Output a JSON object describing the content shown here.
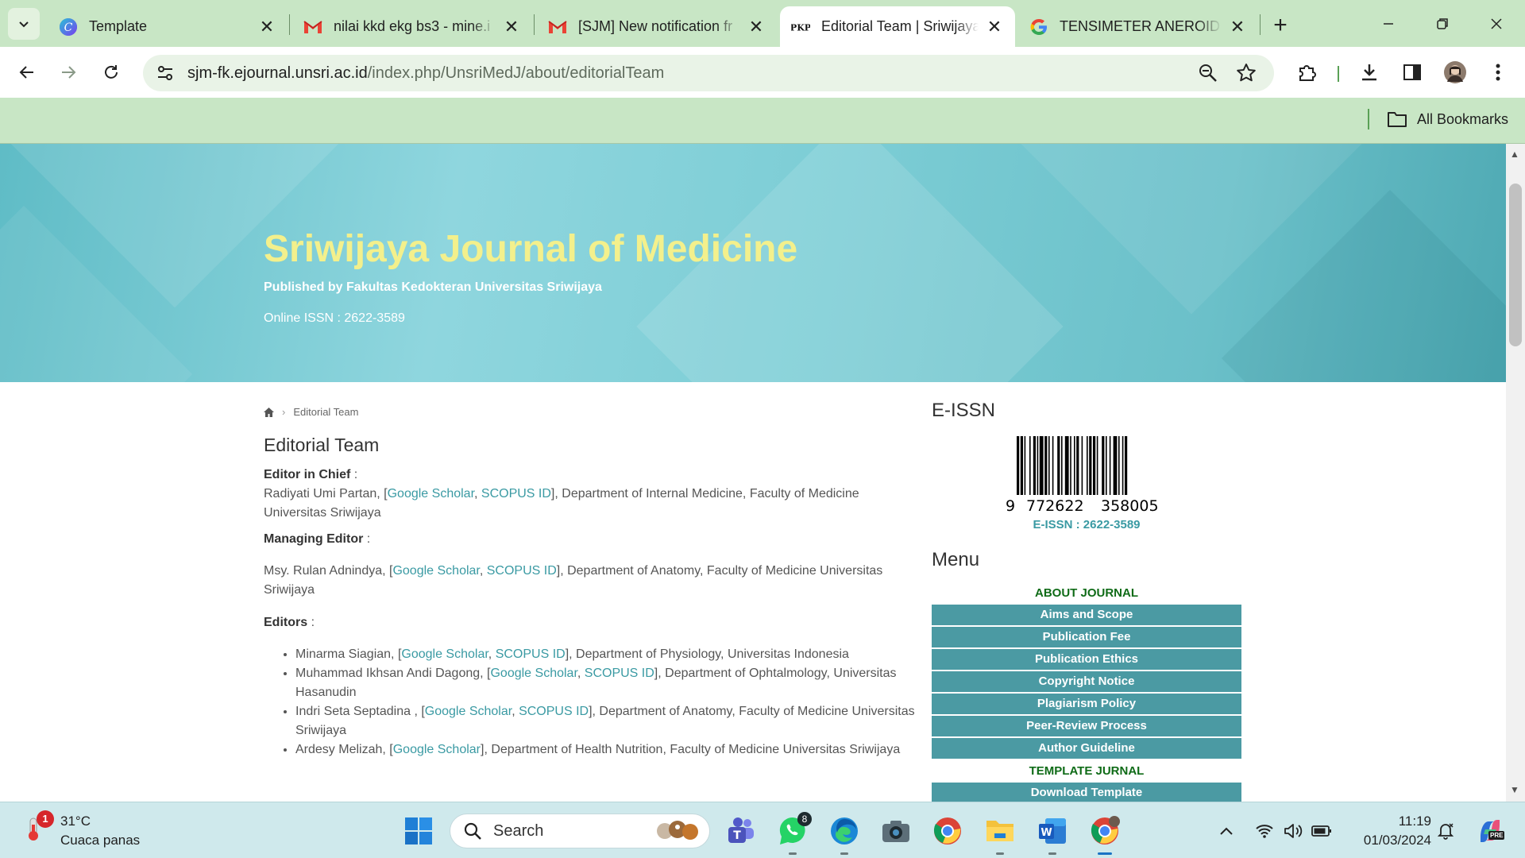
{
  "browser": {
    "tabs": [
      {
        "title": "Template",
        "icon": "canva-icon"
      },
      {
        "title": "nilai kkd ekg bs3 - mine.i",
        "icon": "gmail-icon"
      },
      {
        "title": "[SJM] New notification fr",
        "icon": "gmail-icon"
      },
      {
        "title": "Editorial Team | Sriwijaya",
        "icon": "pkp-icon",
        "active": true
      },
      {
        "title": "TENSIMETER ANEROID -",
        "icon": "google-icon"
      }
    ],
    "pkp_label": "PKP",
    "url_host": "sjm-fk.ejournal.unsri.ac.id",
    "url_path": "/index.php/UnsriMedJ/about/editorialTeam",
    "bookmarks_label": "All Bookmarks"
  },
  "header": {
    "title": "Sriwijaya Journal of Medicine",
    "publisher": "Published by Fakultas Kedokteran Universitas Sriwijaya",
    "issn": "Online ISSN : 2622-3589"
  },
  "breadcrumb": {
    "current": "Editorial Team"
  },
  "page_title": "Editorial Team",
  "editors": {
    "chief_label": "Editor in Chief",
    "chief": {
      "name": "Radiyati Umi Partan, [",
      "scholar": "Google Scholar",
      "scopus": "SCOPUS ID",
      "affil": "], Department of Internal Medicine, Faculty of Medicine Universitas Sriwijaya"
    },
    "managing_label": "Managing Editor",
    "managing": {
      "name": "Msy. Rulan Adnindya, [",
      "scholar": "Google Scholar",
      "scopus": "SCOPUS ID",
      "affil": "], Department of Anatomy, Faculty of Medicine Universitas Sriwijaya"
    },
    "editors_label": "Editors",
    "list": [
      {
        "name": "Minarma Siagian, [",
        "scholar": "Google Scholar",
        "scopus": "SCOPUS ID",
        "affil": "], Department of Physiology, Universitas Indonesia"
      },
      {
        "name": "Muhammad Ikhsan Andi Dagong, [",
        "scholar": "Google Scholar",
        "scopus": "SCOPUS ID",
        "affil": "], Department of Ophtalmology, Universitas Hasanudin"
      },
      {
        "name": "Indri Seta Septadina , [",
        "scholar": "Google Scholar",
        "scopus": "SCOPUS ID",
        "affil": "], Department of Anatomy, Faculty of Medicine Universitas Sriwijaya"
      },
      {
        "name": "Ardesy Melizah, [",
        "scholar": "Google Scholar",
        "scopus": "",
        "affil": "], Department of Health Nutrition, Faculty of Medicine Universitas Sriwijaya"
      }
    ]
  },
  "sidebar": {
    "eissn_heading": "E-ISSN",
    "barcode_digits": {
      "lead": "9",
      "group1": "772622",
      "group2": "358005"
    },
    "eissn_label": "E-ISSN : 2622-3589",
    "menu_heading": "Menu",
    "about_heading": "ABOUT JOURNAL",
    "about_items": [
      "Aims and Scope",
      "Publication Fee",
      "Publication Ethics",
      "Copyright Notice",
      "Plagiarism Policy",
      "Peer-Review Process",
      "Author Guideline"
    ],
    "template_heading": "TEMPLATE JURNAL",
    "template_items": [
      "Download Template"
    ]
  },
  "taskbar": {
    "weather_temp": "31°C",
    "weather_desc": "Cuaca panas",
    "weather_badge": "1",
    "search_placeholder": "Search",
    "whatsapp_badge": "8",
    "time": "11:19",
    "date": "01/03/2024",
    "copilot_badge": "PRE"
  },
  "colors": {
    "chrome_green": "#c8e6c5",
    "hero_teal": "#7ccdd5",
    "title_yellow": "#f3f08c",
    "link_teal": "#3a9aa3",
    "menu_teal": "#4b9aa3",
    "menu_heading_green": "#0f6b17"
  }
}
